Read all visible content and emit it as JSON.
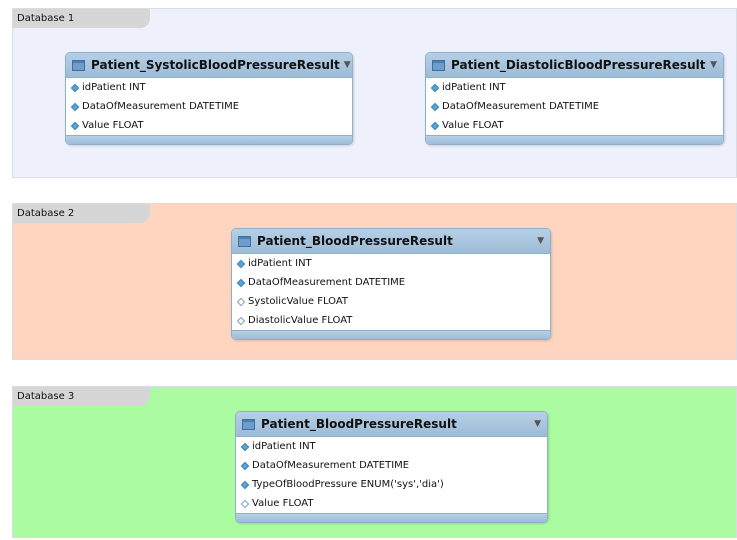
{
  "layers": [
    {
      "name": "Database 1",
      "tables": [
        {
          "title": "Patient_SystolicBloodPressureResult",
          "columns": [
            {
              "text": "idPatient INT",
              "marker": "filled"
            },
            {
              "text": "DataOfMeasurement DATETIME",
              "marker": "filled"
            },
            {
              "text": "Value FLOAT",
              "marker": "filled"
            }
          ]
        },
        {
          "title": "Patient_DiastolicBloodPressureResult",
          "columns": [
            {
              "text": "idPatient INT",
              "marker": "filled"
            },
            {
              "text": "DataOfMeasurement DATETIME",
              "marker": "filled"
            },
            {
              "text": "Value FLOAT",
              "marker": "filled"
            }
          ]
        }
      ]
    },
    {
      "name": "Database 2",
      "tables": [
        {
          "title": "Patient_BloodPressureResult",
          "columns": [
            {
              "text": "idPatient INT",
              "marker": "filled"
            },
            {
              "text": "DataOfMeasurement DATETIME",
              "marker": "filled"
            },
            {
              "text": "SystolicValue FLOAT",
              "marker": "hollow"
            },
            {
              "text": "DiastolicValue FLOAT",
              "marker": "hollow"
            }
          ]
        }
      ]
    },
    {
      "name": "Database 3",
      "tables": [
        {
          "title": "Patient_BloodPressureResult",
          "columns": [
            {
              "text": "idPatient INT",
              "marker": "filled"
            },
            {
              "text": "DataOfMeasurement DATETIME",
              "marker": "filled"
            },
            {
              "text": "TypeOfBloodPressure ENUM('sys','dia')",
              "marker": "filled"
            },
            {
              "text": "Value FLOAT",
              "marker": "hollow"
            }
          ]
        }
      ]
    }
  ],
  "colors": {
    "layer1_bg": "#eef0fb",
    "layer2_bg": "#ffd5c0",
    "layer3_bg": "#abfba0",
    "table_header": "#9dbcd8",
    "key_marker": "#5ba3d6"
  },
  "icons": {
    "table": "table-icon",
    "collapse": "collapse-arrow-icon",
    "column_marker": "column-diamond-icon"
  }
}
